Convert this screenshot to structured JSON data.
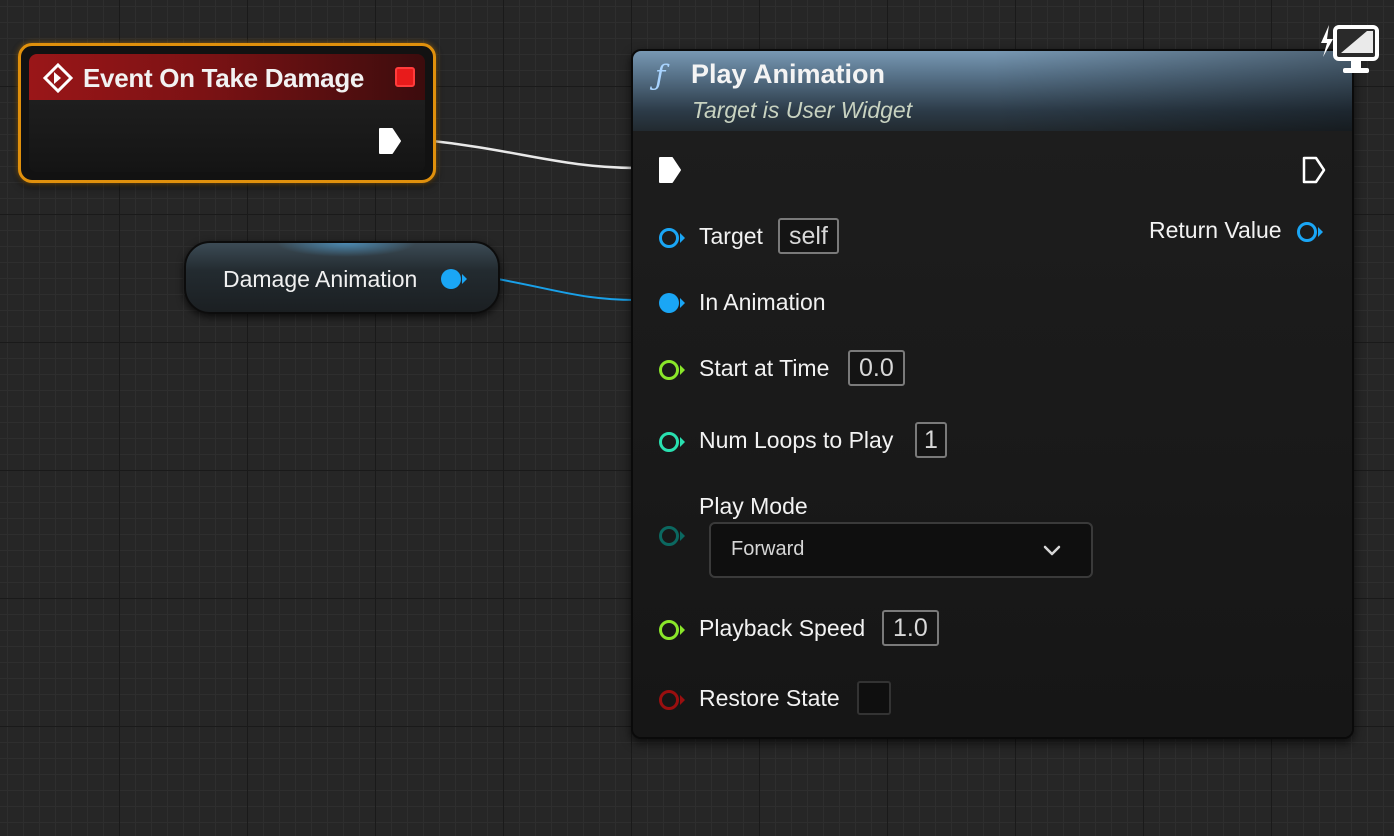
{
  "event_node": {
    "title": "Event On Take Damage",
    "icon": "event-diamond-icon",
    "colors": {
      "border": "#e0900c",
      "header": "#9a1618",
      "stop": "#e81b1b"
    }
  },
  "variable_node": {
    "label": "Damage Animation",
    "pin_color": "#1aa6f5"
  },
  "function_node": {
    "icon_glyph": "ƒ",
    "title": "Play Animation",
    "subtitle": "Target is User Widget",
    "pins": {
      "target": {
        "label": "Target",
        "value": "self",
        "color": "#1aa6f5"
      },
      "return_value": {
        "label": "Return Value",
        "color": "#1aa6f5"
      },
      "in_animation": {
        "label": "In Animation",
        "color": "#1aa6f5"
      },
      "start_at_time": {
        "label": "Start at Time",
        "value": "0.0",
        "color": "#8ae62a"
      },
      "num_loops": {
        "label": "Num Loops to Play",
        "value": "1",
        "color": "#29e0b0"
      },
      "play_mode": {
        "label": "Play Mode",
        "value": "Forward",
        "color": "#0b6860"
      },
      "playback_speed": {
        "label": "Playback Speed",
        "value": "1.0",
        "color": "#8ae62a"
      },
      "restore_state": {
        "label": "Restore State",
        "color": "#9a0f0f"
      }
    }
  },
  "colors": {
    "background": "#262626",
    "exec": "#ffffff"
  },
  "icons": {
    "corner": "widget-blueprint-icon"
  }
}
